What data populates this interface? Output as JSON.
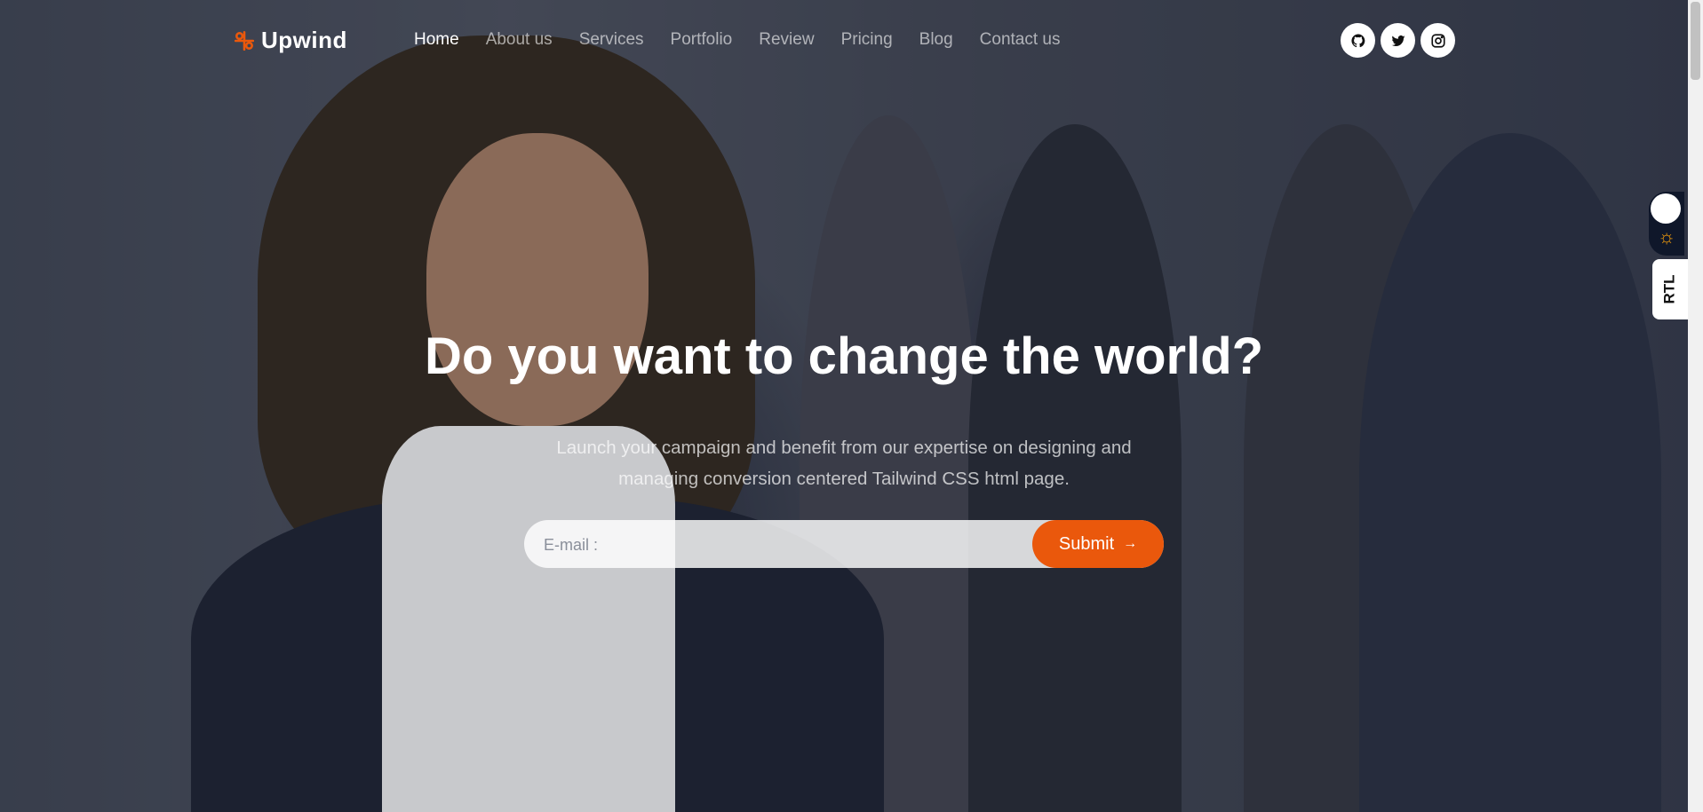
{
  "brand": {
    "name": "Upwind",
    "accent_color": "#ea580c"
  },
  "nav": {
    "items": [
      {
        "label": "Home",
        "active": true
      },
      {
        "label": "About us",
        "active": false
      },
      {
        "label": "Services",
        "active": false
      },
      {
        "label": "Portfolio",
        "active": false
      },
      {
        "label": "Review",
        "active": false
      },
      {
        "label": "Pricing",
        "active": false
      },
      {
        "label": "Blog",
        "active": false
      },
      {
        "label": "Contact us",
        "active": false
      }
    ]
  },
  "socials": [
    {
      "icon": "github-icon"
    },
    {
      "icon": "twitter-icon"
    },
    {
      "icon": "instagram-icon"
    }
  ],
  "hero": {
    "headline": "Do you want to change the world?",
    "subtext_line1": "Launch your campaign and benefit from our expertise on designing and",
    "subtext_line2": "managing conversion centered Tailwind CSS html page.",
    "email_placeholder": "E-mail :",
    "submit_label": "Submit",
    "submit_arrow": "→"
  },
  "theme_toggle": {
    "icon": "sun-icon"
  },
  "rtl_toggle": {
    "label": "RTL"
  }
}
